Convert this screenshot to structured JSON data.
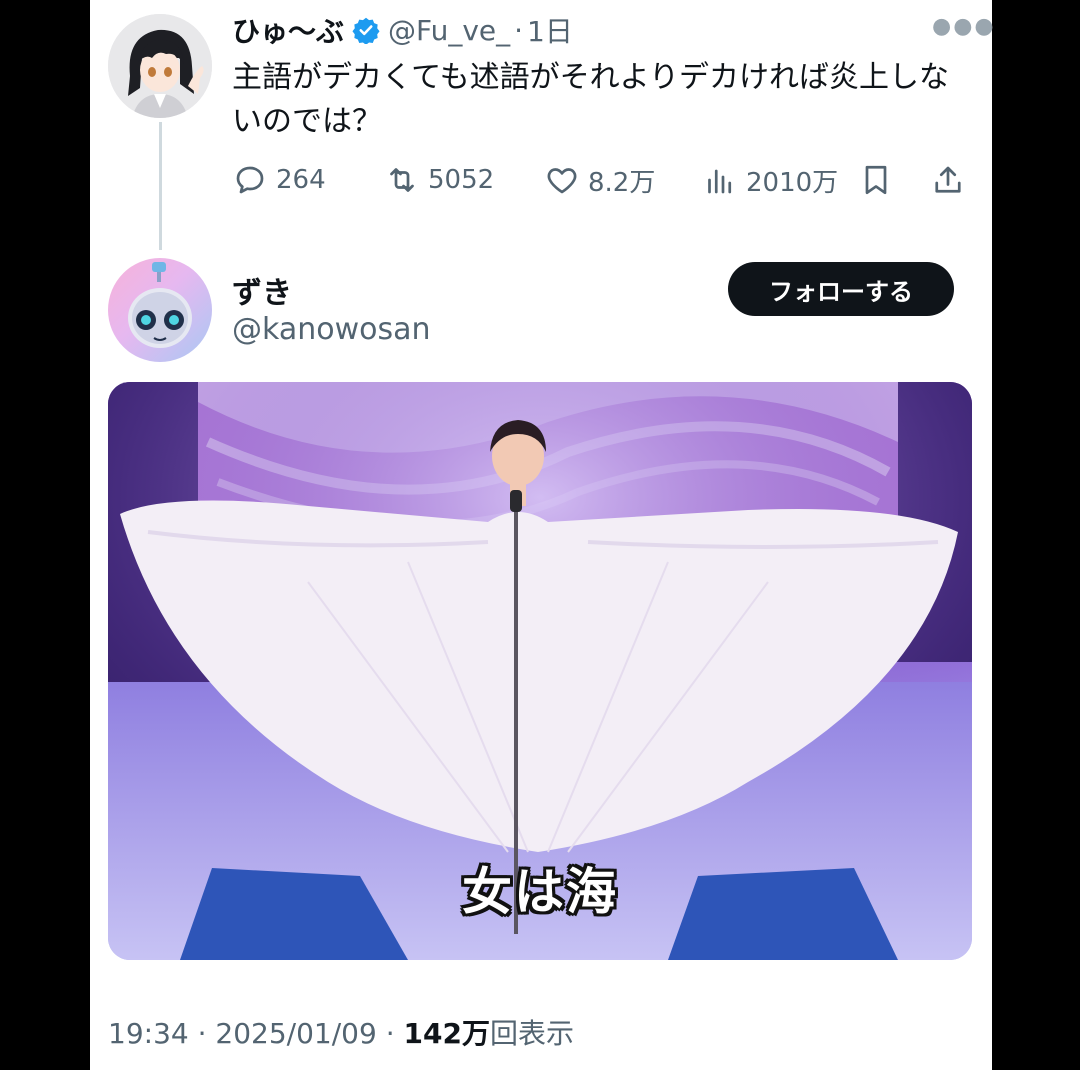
{
  "tweet": {
    "author_name": "ひゅ〜ぶ",
    "author_handle": "@Fu_ve_",
    "separator": "·",
    "age": "1日",
    "text": "主語がデカくても述語がそれよりデカければ炎上しないのでは？",
    "replies": "264",
    "retweets": "5052",
    "likes": "8.2万",
    "views": "2010万",
    "more_icon": "more-dots-icon"
  },
  "quoted": {
    "author_name": "ずき",
    "author_handle": "@kanowosan",
    "follow_label": "フォローする",
    "media_subtitle": "女は海"
  },
  "footer": {
    "time": "19:34",
    "sep1": " · ",
    "date": "2025/01/09",
    "sep2": " · ",
    "view_count": "142万",
    "view_suffix": "回表示"
  },
  "colors": {
    "text_primary": "#0f1419",
    "text_secondary": "#536471",
    "verified_blue": "#1d9bf0",
    "follow_button": "#0f1419"
  },
  "icons": [
    "reply-icon",
    "retweet-icon",
    "like-icon",
    "views-icon",
    "bookmark-icon",
    "share-icon",
    "verified-badge-icon"
  ]
}
